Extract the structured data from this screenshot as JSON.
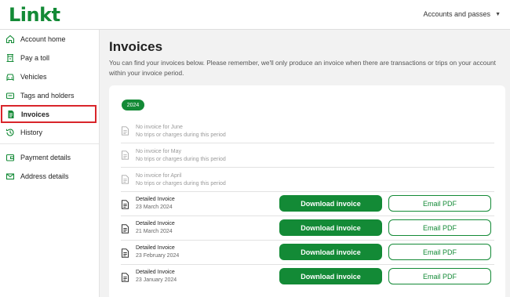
{
  "brand": {
    "logo": "Linkt",
    "accent": "#138a36"
  },
  "header": {
    "account_menu": "Accounts and passes"
  },
  "sidebar": {
    "items": [
      {
        "label": "Account home",
        "icon": "home-icon"
      },
      {
        "label": "Pay a toll",
        "icon": "toll-gate-icon"
      },
      {
        "label": "Vehicles",
        "icon": "car-icon"
      },
      {
        "label": "Tags and holders",
        "icon": "tag-icon"
      },
      {
        "label": "Invoices",
        "icon": "invoice-icon"
      },
      {
        "label": "History",
        "icon": "history-icon"
      },
      {
        "label": "Payment details",
        "icon": "wallet-icon"
      },
      {
        "label": "Address details",
        "icon": "envelope-icon"
      }
    ]
  },
  "main": {
    "title": "Invoices",
    "intro": "You can find your invoices below. Please remember, we'll only produce an invoice when there are transactions or trips on your account within your invoice period.",
    "year": "2024",
    "empty_periods": [
      {
        "title": "No invoice for June",
        "note": "No trips or charges during this period"
      },
      {
        "title": "No invoice for May",
        "note": "No trips or charges during this period"
      },
      {
        "title": "No invoice for April",
        "note": "No trips or charges during this period"
      }
    ],
    "invoices": [
      {
        "title": "Detailed Invoice",
        "date": "23 March 2024"
      },
      {
        "title": "Detailed Invoice",
        "date": "21 March 2024"
      },
      {
        "title": "Detailed Invoice",
        "date": "23 February 2024"
      },
      {
        "title": "Detailed Invoice",
        "date": "23 January 2024"
      }
    ],
    "download_label": "Download invoice",
    "email_label": "Email PDF"
  }
}
